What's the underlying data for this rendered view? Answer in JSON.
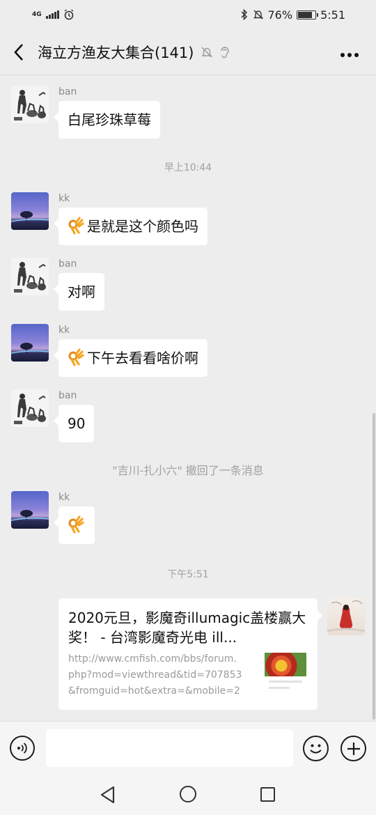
{
  "status_bar": {
    "network": "4G",
    "battery_text": "76%",
    "battery_level": 0.76,
    "time": "5:51"
  },
  "header": {
    "back_icon": "chevron-left-icon",
    "title": "海立方渔友大集合(141)",
    "icons": [
      "mute-bell-icon",
      "ear-icon",
      "more-icon"
    ]
  },
  "messages": [
    {
      "sender": "ban",
      "text": "白尾珍珠草莓",
      "emoji": false
    },
    {
      "sender": "kk",
      "text": "是就是这个颜色吗",
      "emoji": true
    },
    {
      "sender": "ban",
      "text": "对啊",
      "emoji": false
    },
    {
      "sender": "kk",
      "text": "下午去看看啥价啊",
      "emoji": true
    },
    {
      "sender": "ban",
      "text": "90",
      "emoji": false
    },
    {
      "sender": "kk",
      "text": "",
      "emoji": true
    }
  ],
  "timestamps": [
    "早上10:44",
    "下午5:51"
  ],
  "system_notice": "\"吉川-扎小六\" 撤回了一条消息",
  "link_card": {
    "title": "2020元旦，影魔奇illumagic盖楼赢大奖！ - 台湾影魔奇光电 ill...",
    "description": "http://www.cmfish.com/bbs/forum.php?mod=viewthread&tid=707853&fromguid=hot&extra=&mobile=2"
  },
  "input_bar": {
    "icons": [
      "voice-icon",
      "emoji-icon",
      "plus-icon"
    ],
    "placeholder": ""
  },
  "nav_bar": {
    "icons": [
      "back-triangle-icon",
      "home-circle-icon",
      "recents-square-icon"
    ]
  },
  "colors": {
    "background": "#ededed",
    "bubble": "#ffffff",
    "secondary_text": "#a0a0a0"
  }
}
